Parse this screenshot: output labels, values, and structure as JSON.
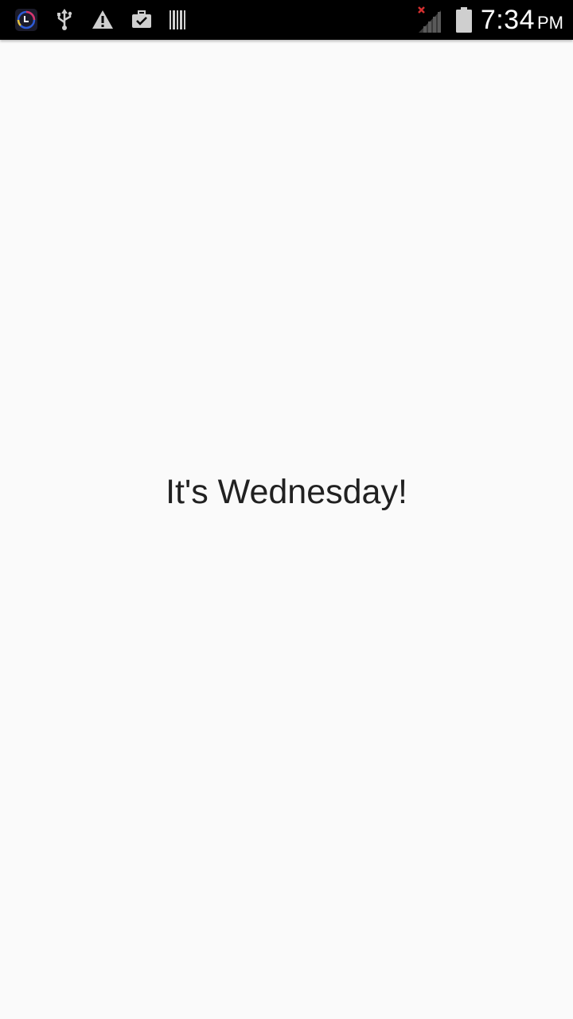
{
  "status_bar": {
    "time": "7:34",
    "ampm": "PM",
    "icons": [
      "app-notification-icon",
      "usb-icon",
      "warning-icon",
      "briefcase-check-icon",
      "barcode-icon",
      "signal-no-service-icon",
      "battery-icon"
    ]
  },
  "main": {
    "message": "It's Wednesday!"
  }
}
